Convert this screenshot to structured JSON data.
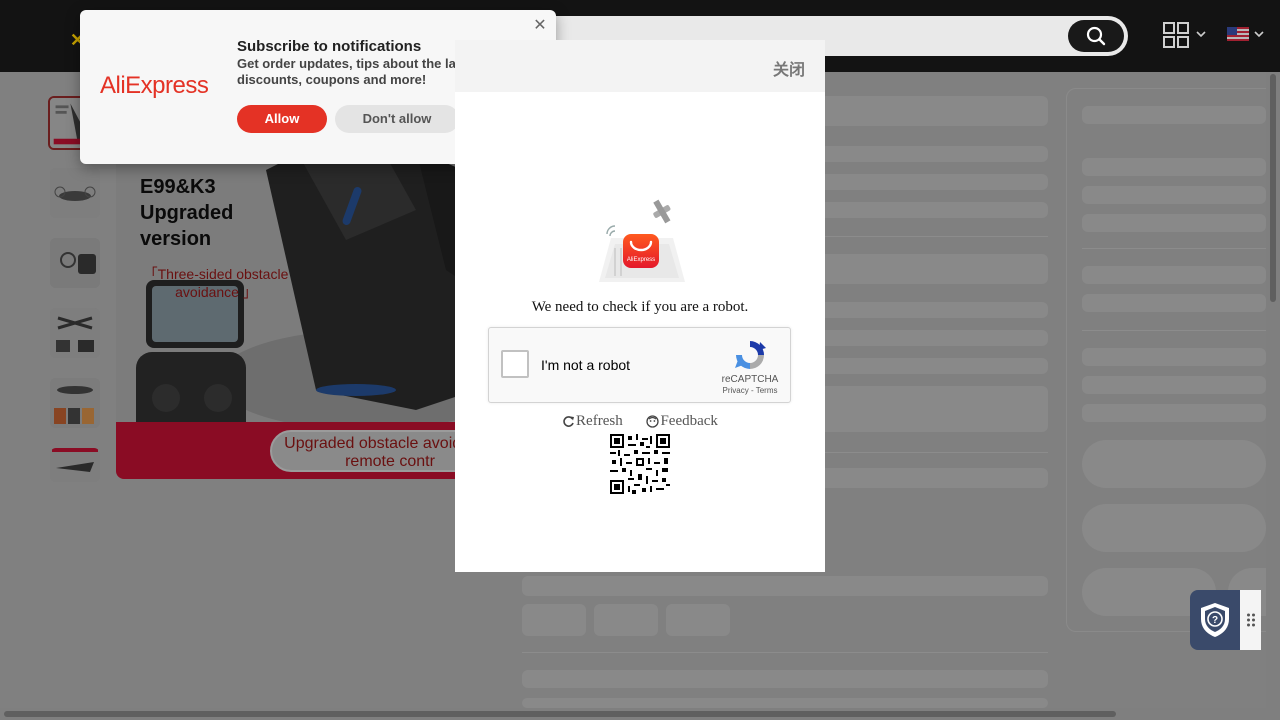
{
  "colors": {
    "brand_red": "#e43225",
    "header_bg": "#131313",
    "overlay_page": "#808080",
    "recaptcha_blue": "#1c3aa9"
  },
  "header": {
    "search_icon": "search-icon",
    "qr_icon": "qr-code-icon",
    "flag_icon": "us-flag-icon"
  },
  "product": {
    "image_title": "E99&K3 Upgraded version",
    "image_subtitle": "「Three-sided obstacle avoidance 」",
    "image_banner": "Upgraded obstacle avoidance remote contr"
  },
  "notification": {
    "logo": "AliExpress",
    "title": "Subscribe to notifications",
    "body": "Get order updates, tips about the lat discounts, coupons and more!",
    "allow": "Allow",
    "deny": "Don't allow"
  },
  "captcha": {
    "close_label": "关闭",
    "app_badge": "AliExpress",
    "message": "We need to check if you are a robot.",
    "checkbox_label": "I'm not a robot",
    "brand": "reCAPTCHA",
    "privacy": "Privacy",
    "separator": " - ",
    "terms": "Terms",
    "refresh": "Refresh",
    "feedback": "Feedback"
  }
}
